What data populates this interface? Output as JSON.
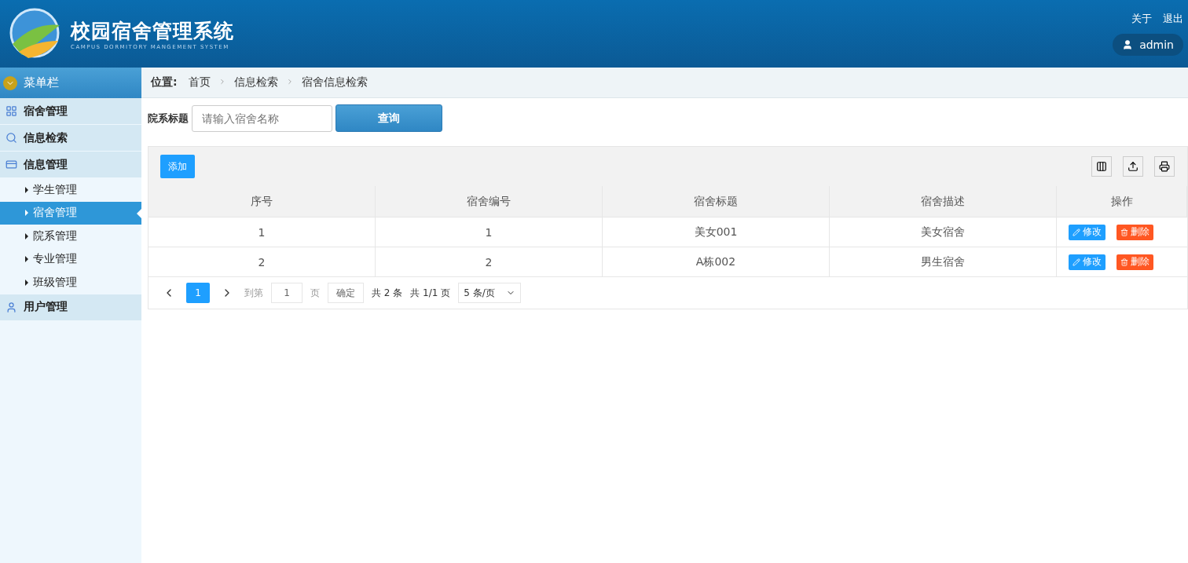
{
  "header": {
    "title": "校园宿舍管理系统",
    "subtitle": "CAMPUS DORMITORY MANGEMENT SYSTEM",
    "links": [
      "关于",
      "退出"
    ],
    "user": "admin"
  },
  "sidebar": {
    "title": "菜单栏",
    "groups": [
      {
        "label": "宿舍管理"
      },
      {
        "label": "信息检索"
      },
      {
        "label": "信息管理",
        "children": [
          {
            "label": "学生管理",
            "selected": false
          },
          {
            "label": "宿舍管理",
            "selected": true
          },
          {
            "label": "院系管理",
            "selected": false
          },
          {
            "label": "专业管理",
            "selected": false
          },
          {
            "label": "班级管理",
            "selected": false
          }
        ]
      },
      {
        "label": "用户管理"
      }
    ]
  },
  "breadcrumb": {
    "label": "位置:",
    "items": [
      "首页",
      "信息检索",
      "宿舍信息检索"
    ]
  },
  "search": {
    "label": "院系标题",
    "placeholder": "请输入宿舍名称",
    "button": "查询"
  },
  "table": {
    "add_button": "添加",
    "columns": [
      "序号",
      "宿舍编号",
      "宿舍标题",
      "宿舍描述",
      "操作"
    ],
    "rows": [
      {
        "cells": [
          "1",
          "1",
          "美女001",
          "美女宿舍"
        ],
        "edit": "修改",
        "delete": "删除"
      },
      {
        "cells": [
          "2",
          "2",
          "A栋002",
          "男生宿舍"
        ],
        "edit": "修改",
        "delete": "删除"
      }
    ]
  },
  "pagination": {
    "pages": [
      {
        "label": "1",
        "selected": true
      }
    ],
    "goto_label": "到第",
    "goto_value": "1",
    "page_unit": "页",
    "confirm": "确定",
    "total": "共 2 条",
    "page_total": "共 1/1 页",
    "page_size": "5 条/页"
  }
}
